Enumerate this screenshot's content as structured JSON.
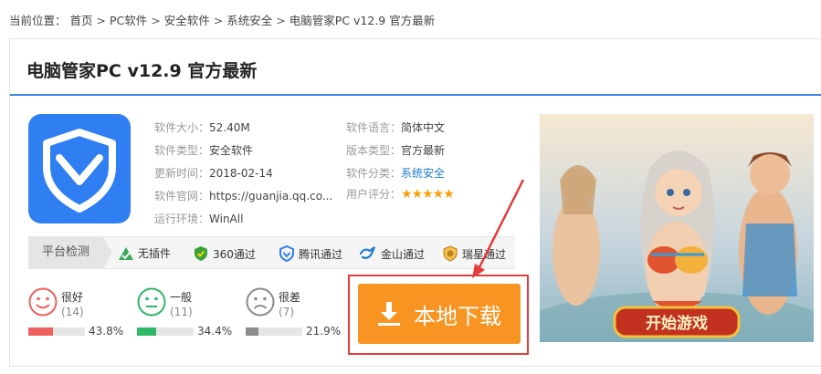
{
  "breadcrumb": {
    "prefix": "当前位置：",
    "items": [
      "首页",
      "PC软件",
      "安全软件",
      "系统安全",
      "电脑管家PC v12.9 官方最新"
    ],
    "separator": ">"
  },
  "title": "电脑管家PC v12.9 官方最新",
  "info": {
    "size_label": "软件大小：",
    "size": "52.40M",
    "lang_label": "软件语言：",
    "lang": "简体中文",
    "type_label": "软件类型：",
    "type": "安全软件",
    "edition_label": "版本类型：",
    "edition": "官方最新",
    "updated_label": "更新时间：",
    "updated": "2018-02-14",
    "category_label": "软件分类：",
    "category": "系统安全",
    "site_label": "软件官网：",
    "site": "https://guanjia.qq.co...",
    "rating_label": "用户评分：",
    "rating": 5,
    "rating_stars": "★★★★★",
    "env_label": "运行环境：",
    "env": "WinAll"
  },
  "platform": {
    "label": "平台检测",
    "items": [
      {
        "label": "无插件",
        "icon": "green-triangle-icon",
        "color": "#3aa85a"
      },
      {
        "label": "360通过",
        "icon": "360-shield-icon",
        "color": "#3aa33a"
      },
      {
        "label": "腾讯通过",
        "icon": "tencent-shield-icon",
        "color": "#2f7ff3"
      },
      {
        "label": "金山通过",
        "icon": "kingsoft-icon",
        "color": "#1e7bd3"
      },
      {
        "label": "瑞星通过",
        "icon": "rising-lion-icon",
        "color": "#d89a1a"
      }
    ]
  },
  "votes": [
    {
      "label": "很好",
      "count": "(14)",
      "percent": "43.8%",
      "fraction": 0.438,
      "color": "#f06060"
    },
    {
      "label": "一般",
      "count": "(11)",
      "percent": "34.4%",
      "fraction": 0.344,
      "color": "#2fb86a"
    },
    {
      "label": "很差",
      "count": "(7)",
      "percent": "21.9%",
      "fraction": 0.219,
      "color": "#8c8c8c"
    }
  ],
  "download": {
    "label": "本地下载",
    "color": "#f89522"
  },
  "ad": {
    "text": "开始游戏"
  }
}
